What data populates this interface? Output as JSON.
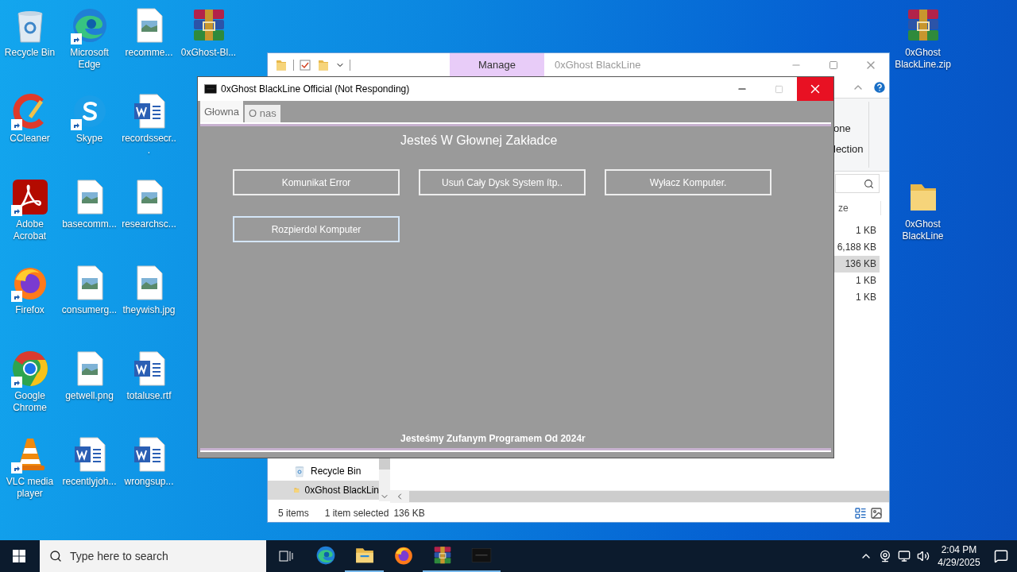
{
  "desktop": {
    "columns": [
      [
        {
          "label": "Recycle Bin",
          "kind": "recycle",
          "shortcut": false
        },
        {
          "label": "CCleaner",
          "kind": "ccleaner",
          "shortcut": true
        },
        {
          "label": "Adobe Acrobat",
          "kind": "acrobat",
          "shortcut": true
        },
        {
          "label": "Firefox",
          "kind": "firefox",
          "shortcut": true
        },
        {
          "label": "Google Chrome",
          "kind": "chrome",
          "shortcut": true
        },
        {
          "label": "VLC media player",
          "kind": "vlc",
          "shortcut": true
        }
      ],
      [
        {
          "label": "Microsoft Edge",
          "kind": "edge",
          "shortcut": true
        },
        {
          "label": "Skype",
          "kind": "skype",
          "shortcut": true
        },
        {
          "label": "basecomm...",
          "kind": "image",
          "shortcut": false
        },
        {
          "label": "consumerg...",
          "kind": "image",
          "shortcut": false
        },
        {
          "label": "getwell.png",
          "kind": "image",
          "shortcut": false
        },
        {
          "label": "recentlyjoh...",
          "kind": "word",
          "shortcut": false
        }
      ],
      [
        {
          "label": "recomme...",
          "kind": "image",
          "shortcut": false
        },
        {
          "label": "recordssecr...",
          "kind": "word",
          "shortcut": false
        },
        {
          "label": "researchsc...",
          "kind": "image",
          "shortcut": false
        },
        {
          "label": "theywish.jpg",
          "kind": "image",
          "shortcut": false
        },
        {
          "label": "totaluse.rtf",
          "kind": "word",
          "shortcut": false
        },
        {
          "label": "wrongsup...",
          "kind": "word",
          "shortcut": false
        }
      ],
      [
        {
          "label": "0xGhost-Bl...",
          "kind": "winrar",
          "shortcut": false
        }
      ]
    ],
    "right_icons": [
      {
        "label": "0xGhost BlackLine.zip",
        "kind": "winrar",
        "shortcut": false
      },
      {
        "label": "0xGhost BlackLine",
        "kind": "folder",
        "shortcut": false
      }
    ]
  },
  "explorer": {
    "ribbon_tab": "Manage",
    "title": "0xGhost BlackLine",
    "ribbon_fragments": [
      "one",
      "lection"
    ],
    "size_header": "ze",
    "sizes": [
      {
        "text": "1 KB",
        "selected": false
      },
      {
        "text": "6,188 KB",
        "selected": false
      },
      {
        "text": "136 KB",
        "selected": true
      },
      {
        "text": "1 KB",
        "selected": false
      },
      {
        "text": "1 KB",
        "selected": false
      }
    ],
    "nav_items": [
      {
        "label": "Recycle Bin",
        "kind": "recycle",
        "selected": false
      },
      {
        "label": "0xGhost BlackLin",
        "kind": "folder",
        "selected": true
      }
    ],
    "status": {
      "items": "5 items",
      "selection": "1 item selected",
      "size": "136 KB"
    }
  },
  "app": {
    "title": "0xGhost BlackLine Official (Not Responding)",
    "tabs": [
      {
        "label": "Głowna",
        "selected": true
      },
      {
        "label": "O nas",
        "selected": false
      }
    ],
    "heading": "Jesteś W Głownej Zakładce",
    "buttons": [
      {
        "label": "Komunikat Error",
        "focused": false
      },
      {
        "label": "Usuń Cały Dysk System ítp..",
        "focused": false
      },
      {
        "label": "Wyłacz Komputer.",
        "focused": false
      },
      {
        "label": "Rozpierdol Komputer",
        "focused": true
      }
    ],
    "footer": "Jesteśmy Zufanym Programem Od 2024r"
  },
  "taskbar": {
    "search_placeholder": "Type here to search",
    "apps": [
      {
        "kind": "edge",
        "active": false
      },
      {
        "kind": "explorer",
        "active": true
      },
      {
        "kind": "firefox",
        "active": false
      },
      {
        "kind": "winrar",
        "active": true
      },
      {
        "kind": "app",
        "active": true
      }
    ],
    "time": "2:04 PM",
    "date": "4/29/2025"
  }
}
